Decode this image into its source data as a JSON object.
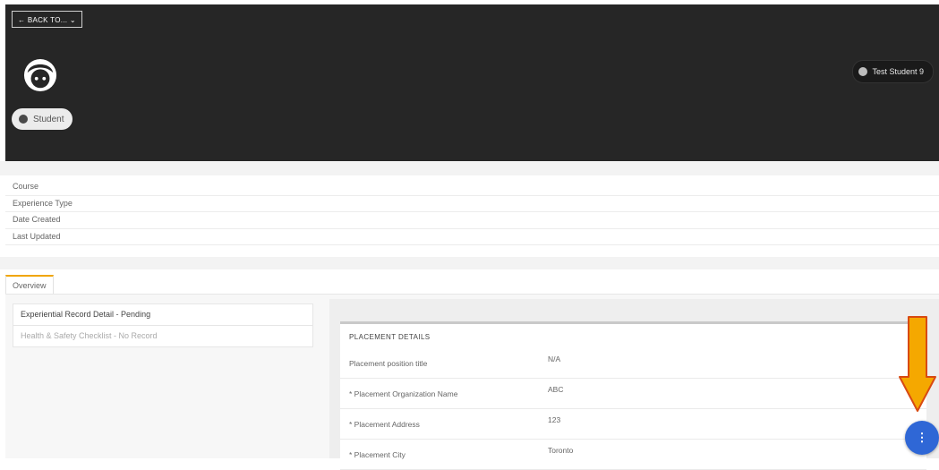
{
  "header": {
    "back_label": "← BACK TO...  ⌄",
    "role_label": "Student",
    "user_label": "Test Student 9",
    "bg_color": "#262626"
  },
  "info": {
    "rows": [
      "Course",
      "Experience Type",
      "Date Created",
      "Last Updated"
    ]
  },
  "tabs": [
    {
      "label": "Overview",
      "active": true
    }
  ],
  "sidebar": {
    "items": [
      {
        "label": "Experiential Record Detail - Pending",
        "active": true
      },
      {
        "label": "Health & Safety Checklist - No Record",
        "active": false
      }
    ]
  },
  "placement": {
    "title": "PLACEMENT DETAILS",
    "fields": [
      {
        "label": "Placement position title",
        "value": "N/A"
      },
      {
        "label": "* Placement Organization Name",
        "value": "ABC"
      },
      {
        "label": "* Placement Address",
        "value": "123"
      },
      {
        "label": "* Placement City",
        "value": "Toronto"
      }
    ]
  },
  "fab": {
    "glyph": "⋮",
    "color": "#2f67d6"
  },
  "annotation": {
    "arrow_color": "#f5a800",
    "icon": "down-arrow-icon"
  }
}
